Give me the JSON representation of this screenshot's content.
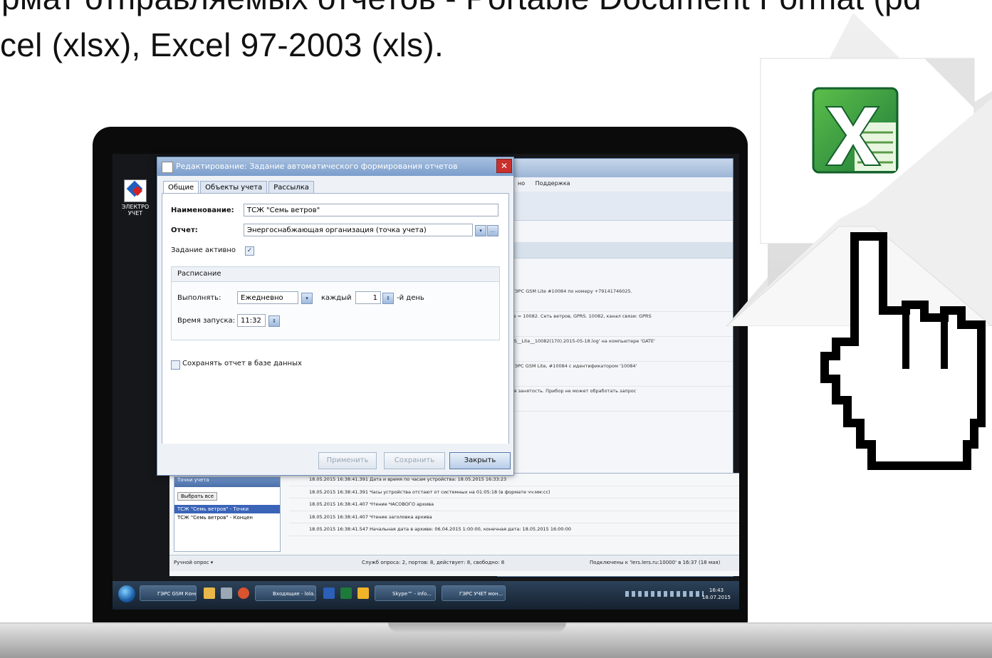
{
  "headline": {
    "line1": "рмат отправляемых отчетов - Portable Document Format (pd",
    "line2": "cel (xlsx), Excel 97-2003 (xls)."
  },
  "desktop": {
    "icon_label": "ЭЛЕКТРО УЧЕТ"
  },
  "bg_window": {
    "menu": [
      "но",
      "Поддержка"
    ],
    "log_lines": [
      "ера ГЭРС GSM Lite #10084 по номеру +79141746025.",
      "M Lite = 10082. Сеть ветров, GPRS. 10082, канал связи: GPRS",
      "_GPRS__Lite__10082(170).2015-05-18.log' на компьютере 'GATE'",
      "ерс ГЭРС GSM Lite, #10084 с идентификатором '10084'",
      "енная занятость. Прибор не может обработать запрос"
    ]
  },
  "lower": {
    "tree_header": "Точки учета",
    "select_all": "Выбрать все",
    "tree_items": [
      "ТСЖ \"Семь ветров\" - Точки",
      "ТСЖ \"Семь ветров\" - Концен"
    ],
    "events": [
      "18.05.2015 16:38:41.391   Дата и время по часам устройства: 18.05.2015 16:33:23",
      "18.05.2015 16:38:41.391   Часы устройства отстают от системных на 01:05:18 (в формате чч:мм:сс)",
      "18.05.2015 16:38:41.407   Чтение ЧАСОВОГО архива",
      "18.05.2015 16:38:41.407   Чтение заголовка архива",
      "18.05.2015 16:38:41.547   Начальная дата в архиве: 06.04.2015 1:00:00, конечная дата: 18.05.2015 16:00:00"
    ],
    "status": {
      "manual": "Ручной опрос ▾",
      "services": "Служб опроса: 2, портов: 8, действует: 8, свободно: 8",
      "connected": "Подключены к 'lers.lers.ru:10000' в 16:37 (18 мая)"
    }
  },
  "taskbar": {
    "items": [
      "ГЭРС GSM Конф...",
      "Входящие - lola...",
      "Skype™ - info...",
      "ГЭРС УЧЕТ мон..."
    ],
    "clock_time": "16:43",
    "clock_date": "18.07.2015"
  },
  "dialog": {
    "title": "Редактирование: Задание автоматического формирования отчетов",
    "close_glyph": "✕",
    "tabs": [
      "Общие",
      "Объекты учета",
      "Рассылка"
    ],
    "name_label": "Наименование:",
    "name_value": "ТСЖ \"Семь ветров\"",
    "report_label": "Отчет:",
    "report_value": "Энергоснабжающая организация (точка учета)",
    "active_label": "Задание активно",
    "active_check": "✓",
    "schedule_title": "Расписание",
    "run_label": "Выполнять:",
    "run_value": "Ежедневно",
    "every_label": "каждый",
    "every_value": "1",
    "day_suffix": "-й день",
    "start_label": "Время запуска:",
    "start_value": "11:32",
    "save_db_label": "Сохранять отчет в базе данных",
    "buttons": {
      "apply": "Применить",
      "save": "Сохранить",
      "close": "Закрыть"
    }
  },
  "colors": {
    "excel_green": "#1e7a3a",
    "dialog_title": "#7a9dcc",
    "close_red": "#c9302c"
  },
  "icons": [
    "excel-icon",
    "envelope-icon",
    "hand-cursor-icon"
  ]
}
